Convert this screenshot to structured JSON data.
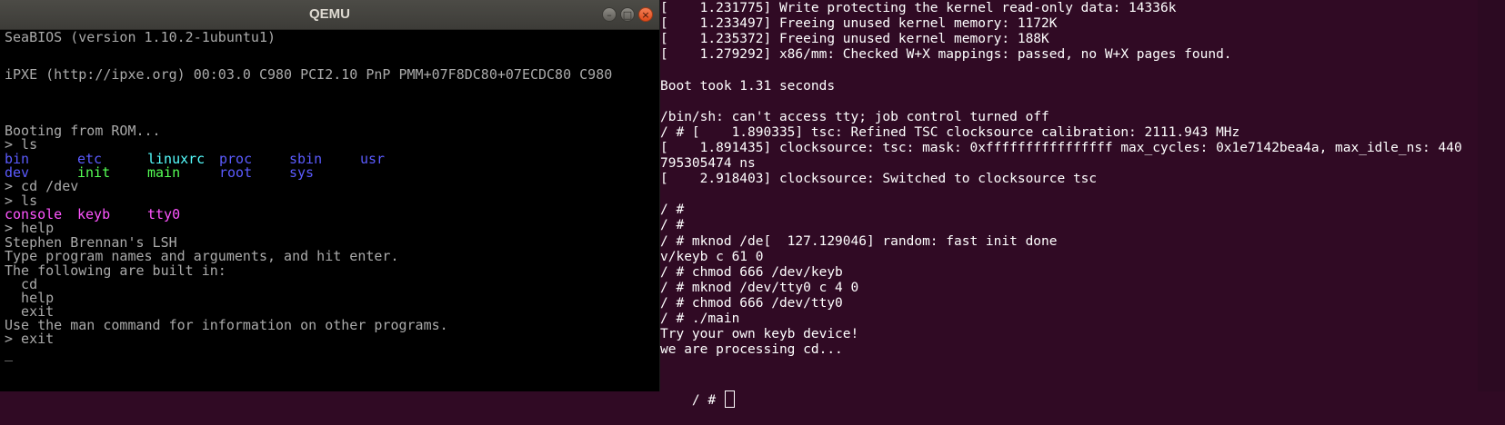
{
  "qemu": {
    "title": "QEMU",
    "buttons": {
      "minimize": "–",
      "maximize": "□",
      "close": "×"
    },
    "screen": {
      "seabios": "SeaBIOS (version 1.10.2-1ubuntu1)",
      "ipxe": "iPXE (http://ipxe.org) 00:03.0 C980 PCI2.10 PnP PMM+07F8DC80+07ECDC80 C980",
      "booting": "Booting from ROM...",
      "cmd_ls_1": "> ls",
      "ls_root": [
        {
          "name": "bin",
          "color": "#5b5bff"
        },
        {
          "name": "etc",
          "color": "#5b5bff"
        },
        {
          "name": "linuxrc",
          "color": "#55ffff"
        },
        {
          "name": "proc",
          "color": "#5b5bff"
        },
        {
          "name": "sbin",
          "color": "#5b5bff"
        },
        {
          "name": "usr",
          "color": "#5b5bff"
        },
        {
          "name": "dev",
          "color": "#5b5bff"
        },
        {
          "name": "init",
          "color": "#55ff55"
        },
        {
          "name": "main",
          "color": "#55ff55"
        },
        {
          "name": "root",
          "color": "#5b5bff"
        },
        {
          "name": "sys",
          "color": "#5b5bff"
        }
      ],
      "cmd_cd": "> cd /dev",
      "cmd_ls_2": "> ls",
      "ls_dev": [
        {
          "name": "console",
          "color": "#ff55ff"
        },
        {
          "name": "keyb",
          "color": "#ff55ff"
        },
        {
          "name": "tty0",
          "color": "#ff55ff"
        }
      ],
      "cmd_help": "> help",
      "help_title": "Stephen Brennan's LSH",
      "help_line1": "Type program names and arguments, and hit enter.",
      "help_line2": "The following are built in:",
      "builtins": [
        "  cd",
        "  help",
        "  exit"
      ],
      "help_line3": "Use the man command for information on other programs.",
      "cmd_exit": "> exit",
      "cursor": "_"
    }
  },
  "terminal": {
    "lines": [
      "[    1.231775] Write protecting the kernel read-only data: 14336k",
      "[    1.233497] Freeing unused kernel memory: 1172K",
      "[    1.235372] Freeing unused kernel memory: 188K",
      "[    1.279292] x86/mm: Checked W+X mappings: passed, no W+X pages found.",
      "",
      "Boot took 1.31 seconds",
      "",
      "/bin/sh: can't access tty; job control turned off",
      "/ # [    1.890335] tsc: Refined TSC clocksource calibration: 2111.943 MHz",
      "[    1.891435] clocksource: tsc: mask: 0xffffffffffffffff max_cycles: 0x1e7142bea4a, max_idle_ns: 440",
      "795305474 ns",
      "[    2.918403] clocksource: Switched to clocksource tsc",
      "",
      "/ #",
      "/ #",
      "/ # mknod /de[  127.129046] random: fast init done",
      "v/keyb c 61 0",
      "/ # chmod 666 /dev/keyb",
      "/ # mknod /dev/tty0 c 4 0",
      "/ # chmod 666 /dev/tty0",
      "/ # ./main",
      "Try your own keyb device!",
      "we are processing cd..."
    ],
    "prompt": "/ # "
  }
}
